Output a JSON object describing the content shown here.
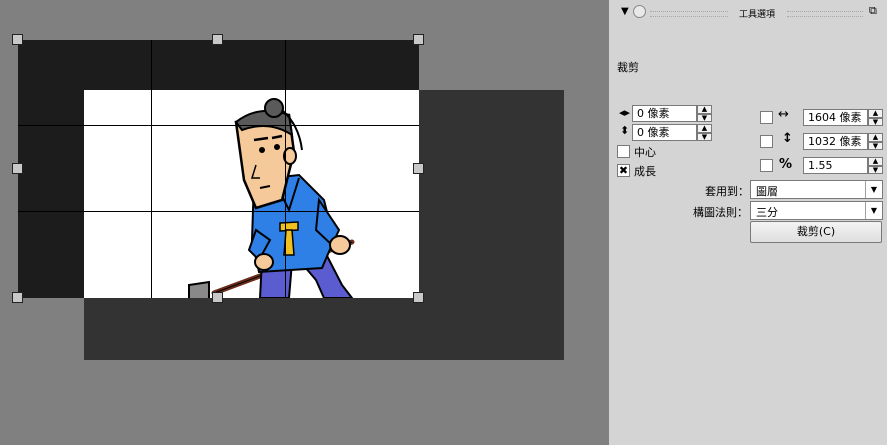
{
  "panel": {
    "title": "工具選項",
    "section_label": "裁剪",
    "offset_x_value": "0 像素",
    "offset_y_value": "0 像素",
    "center_label": "中心",
    "center_checked": false,
    "grow_label": "成長",
    "grow_checked": true,
    "width_value": "1604 像素",
    "height_value": "1032 像素",
    "ratio_value": "1.55",
    "ratio_symbol": "%",
    "width_checked": false,
    "height_checked": false,
    "ratio_checked": false,
    "apply_to_label": "套用到：",
    "apply_to_value": "圖層",
    "composition_label": "構圖法則：",
    "composition_value": "三分",
    "crop_button_label": "裁剪(C)"
  },
  "icons": {
    "collapse": "triangle-down-icon",
    "tool": "tool-circle-icon",
    "undock": "undock-icon",
    "offset_x": "horizontal-offset-icon",
    "offset_y": "vertical-offset-icon",
    "width": "horizontal-arrow-icon",
    "height": "vertical-arrow-icon"
  },
  "colors": {
    "canvas_bg": "#808080",
    "panel_bg": "#d4d4d4",
    "crop_mask": "#1c1c1c",
    "image_shadow": "#333333"
  }
}
